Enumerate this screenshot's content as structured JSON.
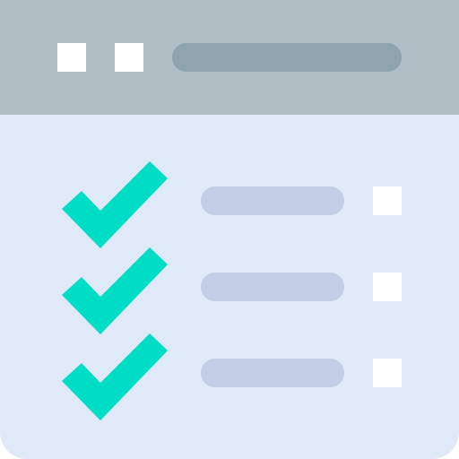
{
  "colors": {
    "titlebar": "#b0bec5",
    "address_bar": "#90a4ae",
    "window_control": "#ffffff",
    "content": "#dfe9f7",
    "list_line": "#c2cfe6",
    "check": "#00ddc6",
    "checkbox": "#ffffff"
  },
  "icons": {
    "window_controls": [
      "window-square-icon",
      "window-square-icon"
    ],
    "list_item_icon": "checkmark-icon"
  },
  "checklist": {
    "items": [
      {
        "checked": true
      },
      {
        "checked": true
      },
      {
        "checked": true
      }
    ]
  }
}
